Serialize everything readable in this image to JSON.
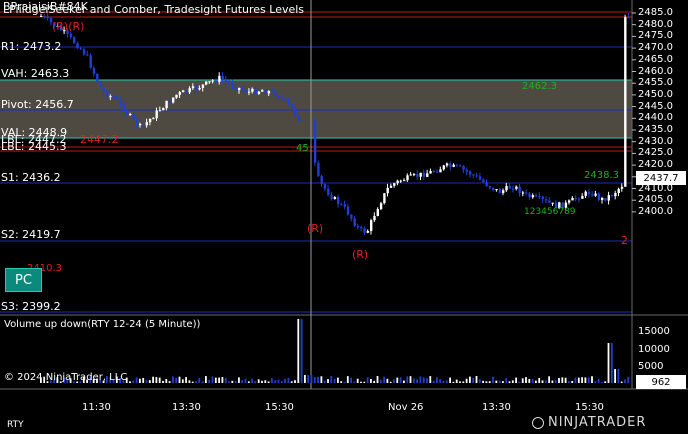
{
  "chart": {
    "title": "LPiiidgeiSeeker and Comber, Tradesight Futures Levels",
    "title_overlay": "BPraiaisiB#84K",
    "volume_title": "Volume up down(RTY 12-24 (5 Minute))",
    "copyright": "© 2024 NinjaTrader, LLC",
    "instrument": "RTY",
    "brand": "NINJATRADER",
    "pc_button": "PC",
    "price_last": "2437.7",
    "volume_last": "962"
  },
  "levels": {
    "r1": "R1: 2473.2",
    "vah": "VAH: 2463.3",
    "pivot": "Pivot: 2456.7",
    "val": "VAL: 2448.9",
    "lbl": "LBL: 2447.2",
    "lbl2": "LBL: 2445.3",
    "s1": "S1: 2436.2",
    "s2": "S2: 2419.7",
    "s3": "S3: 2399.2",
    "red_2447": "2447.2",
    "red_2410": "2410.3",
    "green_2462": "2462.3",
    "green_2438": "2438.3"
  },
  "markers": {
    "r_label": "(R)",
    "rr_label": "(R)(R)",
    "two_label": "2",
    "green_count_a": "45",
    "green_count_b": "123456789"
  },
  "price_axis": [
    "2485.0",
    "2480.0",
    "2475.0",
    "2470.0",
    "2465.0",
    "2460.0",
    "2455.0",
    "2450.0",
    "2445.0",
    "2440.0",
    "2435.0",
    "2430.0",
    "2425.0",
    "2420.0",
    "2415.0",
    "2410.0",
    "2405.0",
    "2400.0"
  ],
  "volume_axis": [
    "15000",
    "10000",
    "5000"
  ],
  "time_axis": [
    "11:30",
    "13:30",
    "15:30",
    "Nov 26",
    "13:30",
    "15:30"
  ],
  "colors": {
    "background": "#000000",
    "up_bar": "#ffffff",
    "down_bar": "#1f3fd8",
    "value_area": "#4e4a42",
    "level_line": "#1a2fb8",
    "red": "#e02020",
    "green": "#1eb21e",
    "teal": "#28c8b4"
  }
}
